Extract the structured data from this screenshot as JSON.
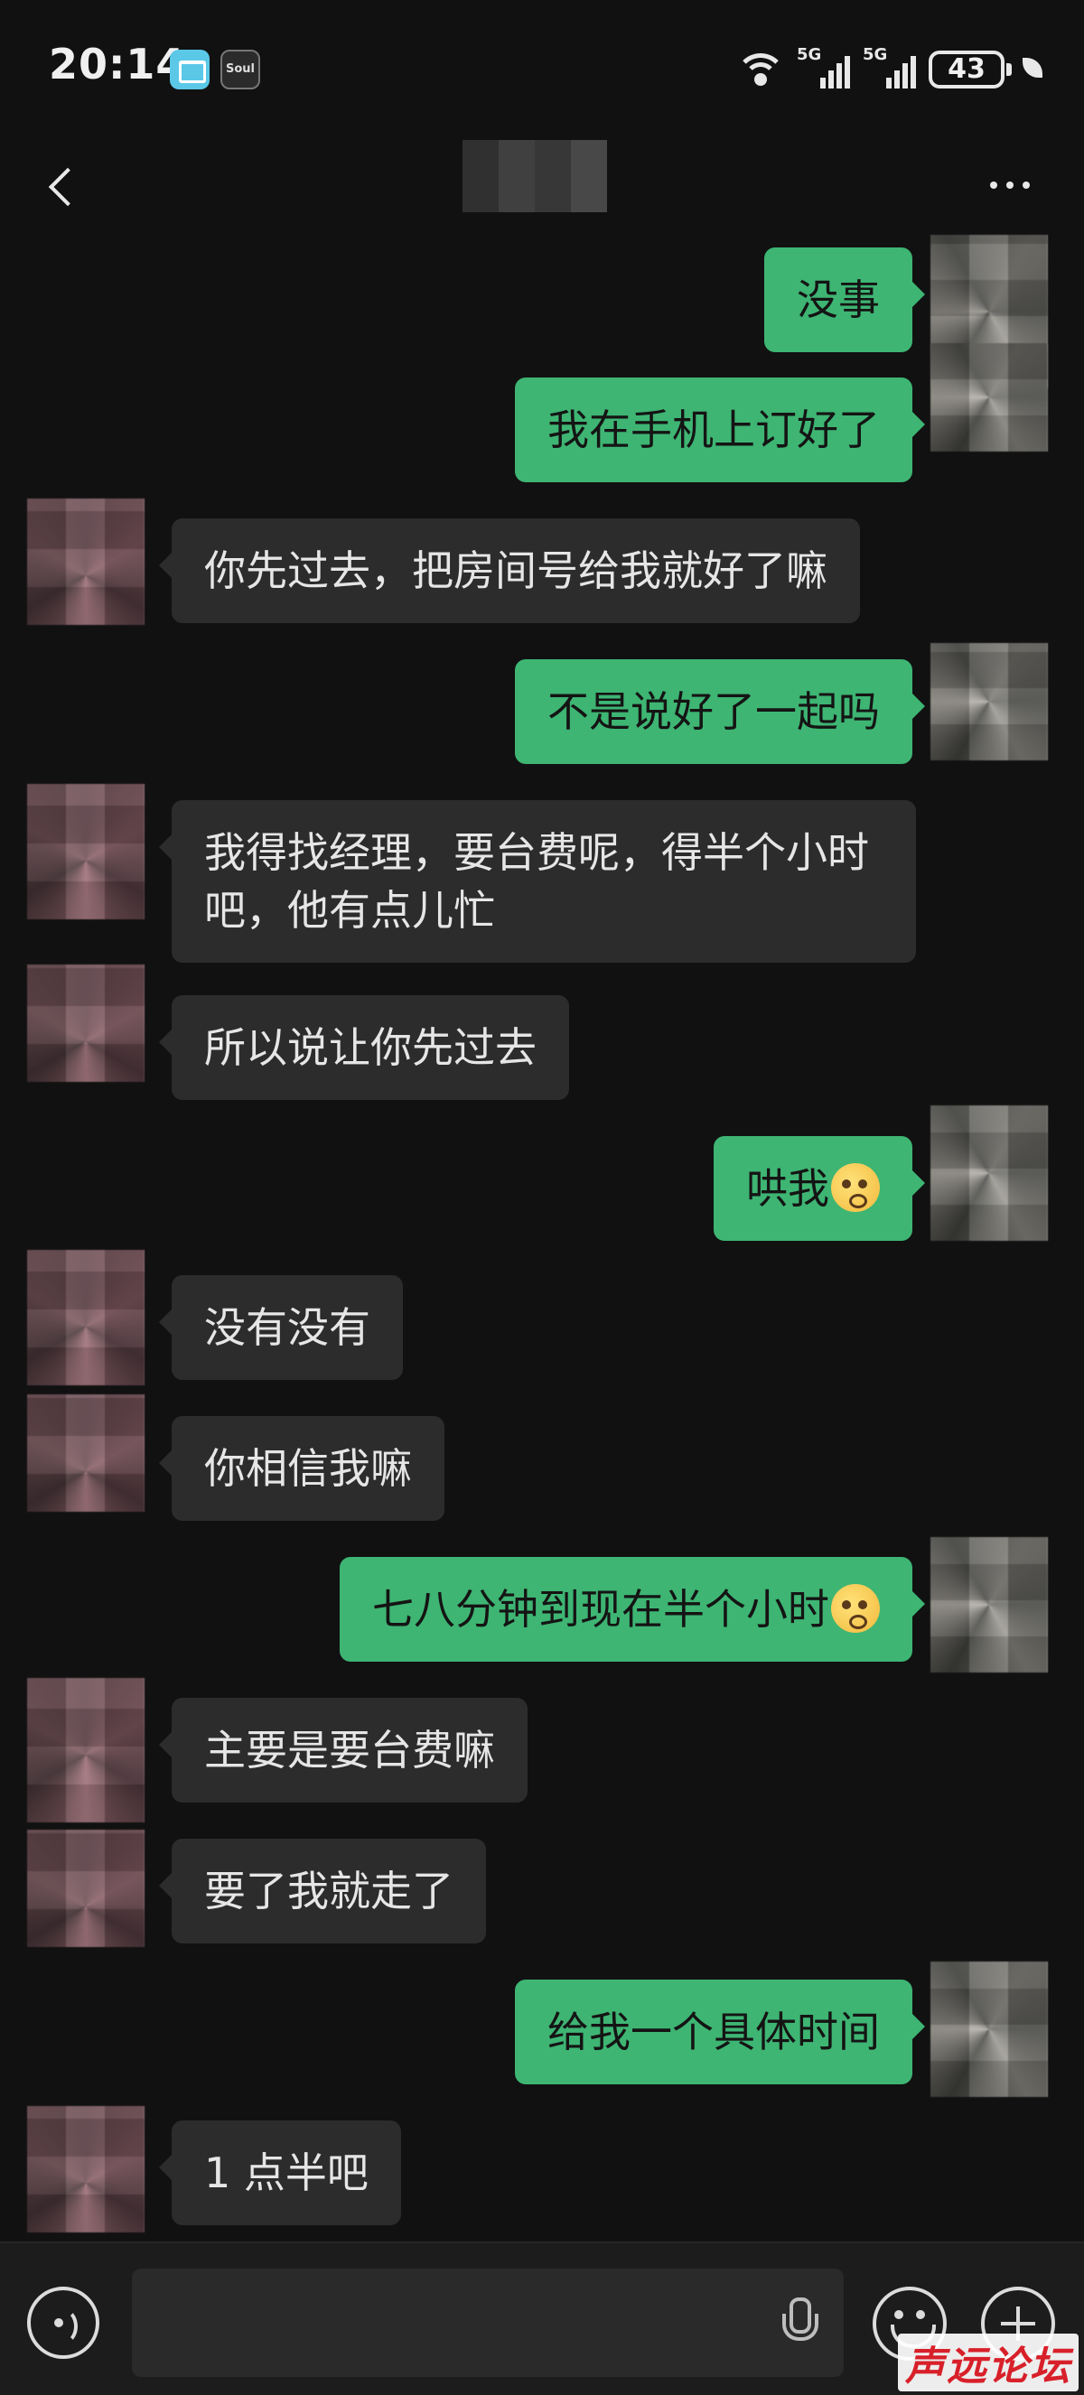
{
  "status_bar": {
    "time": "20:14",
    "soul_icon_label": "Soul",
    "network_1": "5G",
    "network_2": "5G",
    "battery": "43"
  },
  "header": {
    "back_icon": "chevron-left-icon",
    "more_icon": "more-dots-icon"
  },
  "messages": [
    {
      "side": "out",
      "text": "没事"
    },
    {
      "side": "out",
      "text": "我在手机上订好了"
    },
    {
      "side": "in",
      "text": "你先过去，把房间号给我就好了嘛"
    },
    {
      "side": "out",
      "text": "不是说好了一起吗"
    },
    {
      "side": "in",
      "text": "我得找经理，要台费呢，得半个小时吧，他有点儿忙"
    },
    {
      "side": "in",
      "text": "所以说让你先过去"
    },
    {
      "side": "out",
      "text": "哄我",
      "emoji": "thinking-face-emoji"
    },
    {
      "side": "in",
      "text": "没有没有"
    },
    {
      "side": "in",
      "text": "你相信我嘛"
    },
    {
      "side": "out",
      "text": "七八分钟到现在半个小时",
      "emoji": "pleading-face-emoji"
    },
    {
      "side": "in",
      "text": "主要是要台费嘛"
    },
    {
      "side": "in",
      "text": "要了我就走了"
    },
    {
      "side": "out",
      "text": "给我一个具体时间"
    },
    {
      "side": "in",
      "text": "1 点半吧"
    }
  ],
  "input_bar": {
    "value": "",
    "voice_icon": "voice-icon",
    "mic_icon": "mic-icon",
    "emoji_icon": "smiley-icon",
    "plus_icon": "plus-icon"
  },
  "watermark": "声远论坛",
  "colors": {
    "background": "#111111",
    "incoming_bubble": "#2c2c2c",
    "outgoing_bubble": "#3eb573"
  }
}
